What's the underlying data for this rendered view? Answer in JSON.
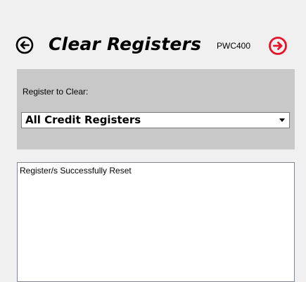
{
  "header": {
    "title": "Clear Registers",
    "code": "PWC400",
    "back_icon": "arrow-left-circle-icon",
    "next_icon": "arrow-right-circle-icon",
    "next_icon_color": "#e8102a"
  },
  "form": {
    "register_label": "Register to Clear:",
    "selected_register": "All Credit Registers"
  },
  "output": {
    "message": "Register/s Successfully Reset"
  },
  "colors": {
    "background": "#f0f0f0",
    "panel": "#c8c8c8",
    "accent": "#e8102a"
  }
}
